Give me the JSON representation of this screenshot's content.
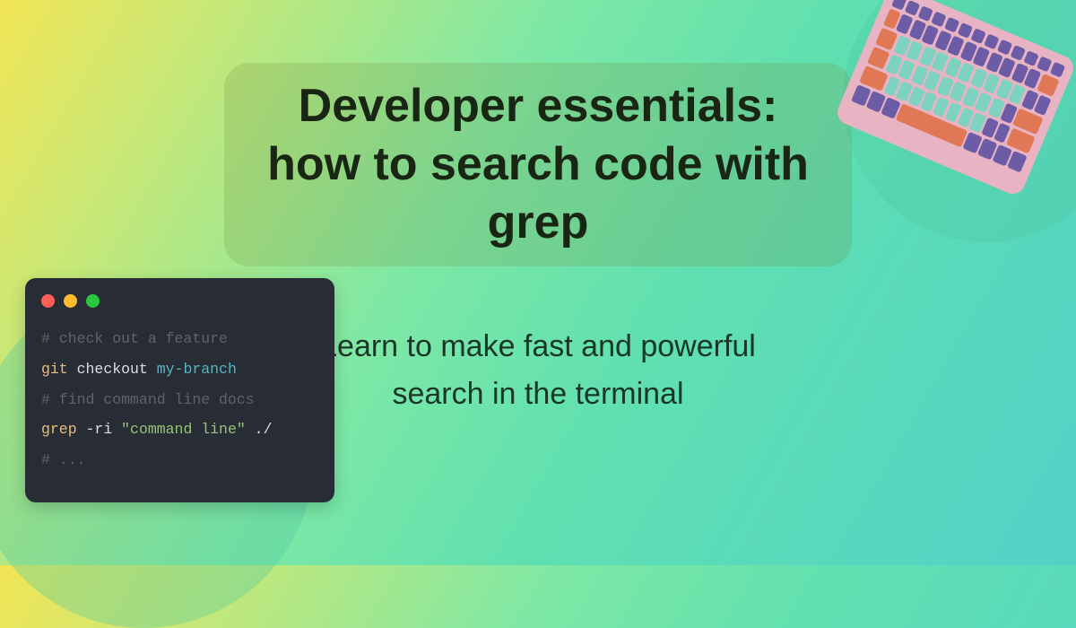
{
  "title": "Developer essentials: how to search code with grep",
  "subtitle": "Learn to make fast and powerful search in the terminal",
  "terminal": {
    "line1": {
      "comment": "# check out a feature"
    },
    "line2": {
      "cmd": "git",
      "arg1": "checkout",
      "arg2": "my-branch"
    },
    "line3": {
      "comment": "# find command line docs"
    },
    "line4": {
      "cmd": "grep",
      "flags": "-ri",
      "string": "\"command line\"",
      "path": "./"
    },
    "line5": {
      "comment": "# ..."
    }
  }
}
